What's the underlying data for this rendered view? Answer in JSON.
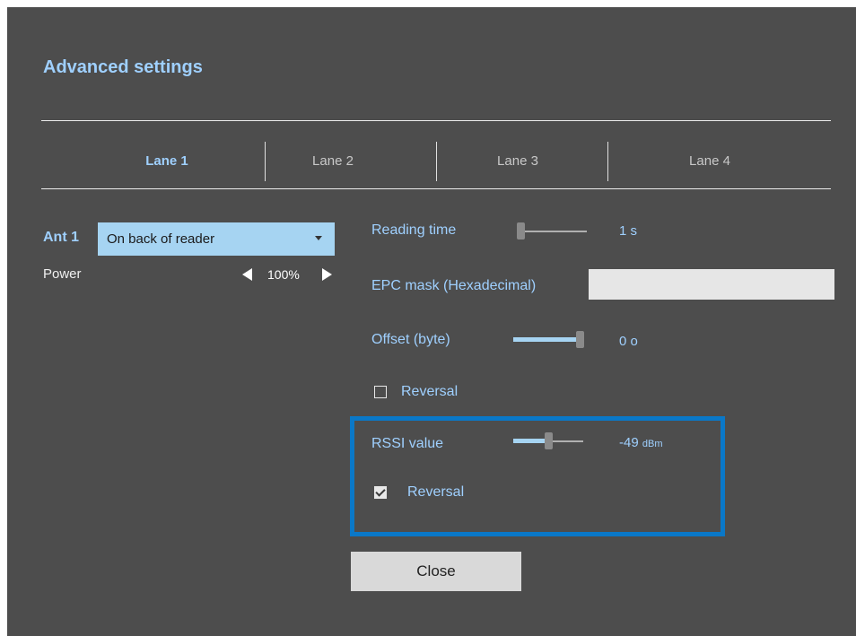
{
  "dialog": {
    "title": "Advanced settings"
  },
  "tabs": [
    {
      "label": "Lane 1",
      "active": true
    },
    {
      "label": "Lane 2",
      "active": false
    },
    {
      "label": "Lane 3",
      "active": false
    },
    {
      "label": "Lane 4",
      "active": false
    }
  ],
  "antenna": {
    "label": "Ant 1",
    "selected": "On back of reader",
    "power_label": "Power",
    "power_value": "100%"
  },
  "reading_time": {
    "label": "Reading time",
    "value": "1 s",
    "slider_fraction": 0.0
  },
  "epc_mask": {
    "label": "EPC mask (Hexadecimal)",
    "value": ""
  },
  "offset": {
    "label": "Offset (byte)",
    "value": "0 o",
    "slider_fraction": 1.0
  },
  "offset_reversal": {
    "label": "Reversal",
    "checked": false
  },
  "rssi": {
    "label": "RSSI value",
    "value": "-49",
    "unit": "dBm",
    "slider_fraction": 0.5
  },
  "rssi_reversal": {
    "label": "Reversal",
    "checked": true
  },
  "close_label": "Close",
  "colors": {
    "background": "#4d4d4d",
    "accent": "#9fd0ff",
    "highlight_border": "#0a78c8",
    "select_bg": "#a6d4f2"
  }
}
